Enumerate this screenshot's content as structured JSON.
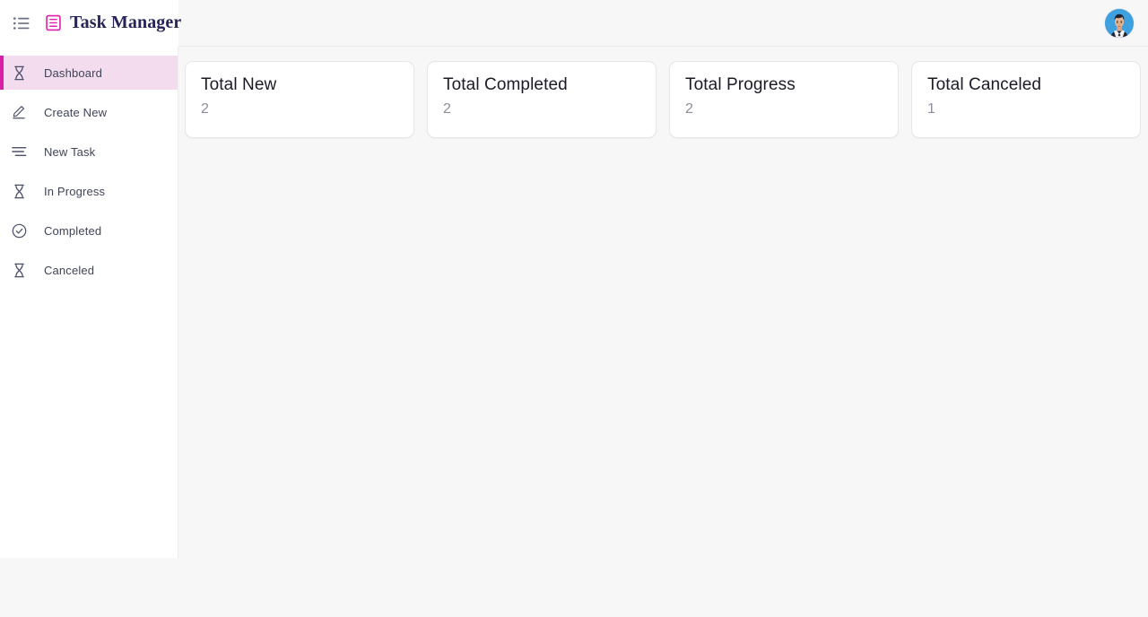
{
  "header": {
    "menu_icon": "list-menu-icon",
    "brand_logo_icon": "document-list-icon",
    "brand_title": "Task Manager",
    "avatar_label": "user-avatar",
    "accent_color": "#d81fa8",
    "title_color": "#27245c"
  },
  "sidebar": {
    "items": [
      {
        "label": "Dashboard",
        "icon": "hourglass-icon",
        "active": true
      },
      {
        "label": "Create New",
        "icon": "pencil-icon",
        "active": false
      },
      {
        "label": "New Task",
        "icon": "sort-lines-icon",
        "active": false
      },
      {
        "label": "In Progress",
        "icon": "hourglass-icon",
        "active": false
      },
      {
        "label": "Completed",
        "icon": "check-circle-icon",
        "active": false
      },
      {
        "label": "Canceled",
        "icon": "hourglass-icon",
        "active": false
      }
    ],
    "active_bg": "#f4dcef",
    "active_bar": "#d81fa8"
  },
  "main": {
    "cards": [
      {
        "title": "Total New",
        "value": "2"
      },
      {
        "title": "Total Completed",
        "value": "2"
      },
      {
        "title": "Total Progress",
        "value": "2"
      },
      {
        "title": "Total Canceled",
        "value": "1"
      }
    ]
  }
}
